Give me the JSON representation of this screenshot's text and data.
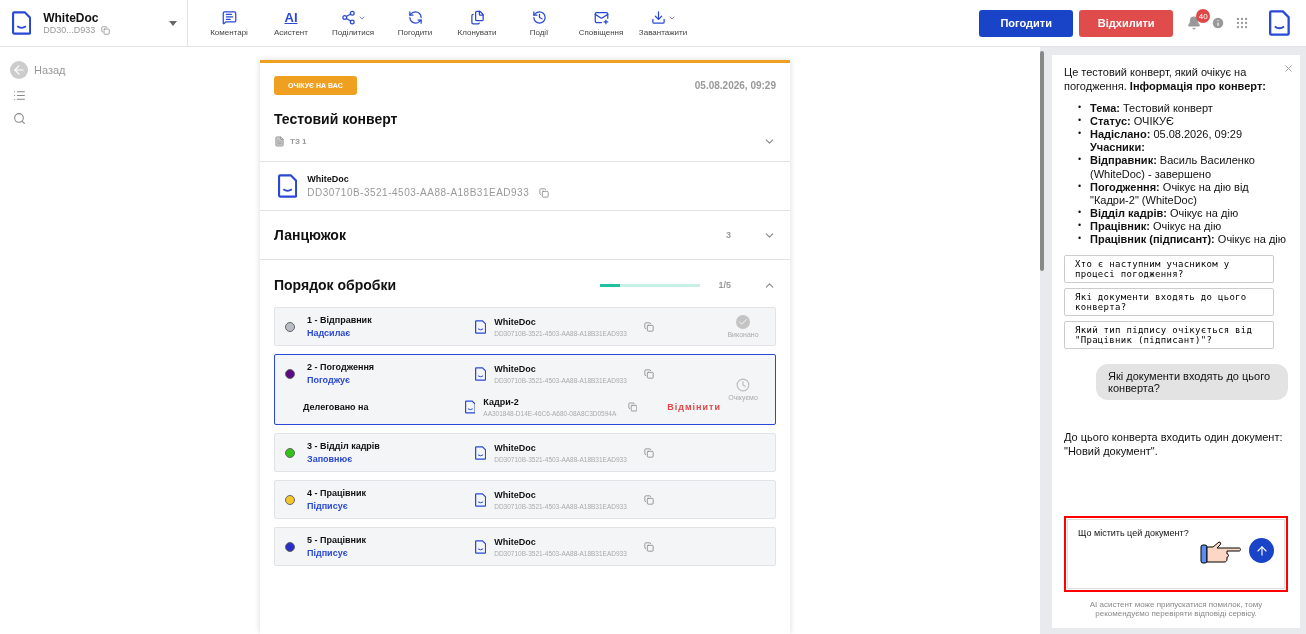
{
  "header": {
    "doc_name": "WhiteDoc",
    "doc_id": "DD30...D933",
    "toolbar": [
      {
        "label": "Коментарі",
        "dropdown": false
      },
      {
        "label": "Асистент",
        "glyph": "AI",
        "dropdown": false
      },
      {
        "label": "Поділитися",
        "dropdown": true
      },
      {
        "label": "Погодити",
        "dropdown": false
      },
      {
        "label": "Клонувати",
        "dropdown": false
      },
      {
        "label": "Події",
        "dropdown": false
      },
      {
        "label": "Сповіщення",
        "dropdown": false
      },
      {
        "label": "Завантажити",
        "dropdown": true
      }
    ],
    "approve": "Погодити",
    "reject": "Відхилити",
    "notification_count": "40"
  },
  "sidebar": {
    "back": "Назад"
  },
  "envelope": {
    "status": "ОЧІКУЄ НА ВАС",
    "date": "05.08.2026, 09:29",
    "title": "Тестовий конверт",
    "doc_type": "ТЗ 1",
    "document": {
      "name": "WhiteDoc",
      "id": "DD30710B-3521-4503-AA88-A18B31EAD933"
    },
    "chain": {
      "title": "Ланцюжок",
      "count": "3",
      "expanded": false
    },
    "processing": {
      "title": "Порядок обробки",
      "level": 0.2,
      "progress": "1/5",
      "expanded": true,
      "steps": [
        {
          "title": "1 - Відправник",
          "action": "Надсилає",
          "color": "#b8bcc4",
          "name": "WhiteDoc",
          "id": "DD30710B-3521-4503-AA88-A18B31EAD933",
          "kind": "done",
          "status_label": "Виконано",
          "selected": false
        },
        {
          "title": "2 - Погодження",
          "action": "Погоджує",
          "color": "#5a0a82",
          "name": "WhiteDoc",
          "id": "DD30710B-3521-4503-AA88-A18B31EAD933",
          "kind": "waiting",
          "status_label": "Очікуємо",
          "selected": true,
          "delegation": {
            "label": "Делеговано на",
            "name": "Кадри-2",
            "id": "AA301848-D14E-46C6-A680-08A8C3D0594A",
            "cancel": "Відмінити"
          }
        },
        {
          "title": "3 - Відділ кадрів",
          "action": "Заповнює",
          "color": "#33c21a",
          "name": "WhiteDoc",
          "id": "DD30710B-3521-4503-AA88-A18B31EAD933",
          "kind": "plain",
          "selected": false
        },
        {
          "title": "4 - Працівник",
          "action": "Підписує",
          "color": "#f5c52a",
          "name": "WhiteDoc",
          "id": "DD30710B-3521-4503-AA88-A18B31EAD933",
          "kind": "plain",
          "selected": false
        },
        {
          "title": "5 - Працівник",
          "action": "Підписує",
          "color": "#2a2ec4",
          "name": "WhiteDoc",
          "id": "DD30710B-3521-4503-AA88-A18B31EAD933",
          "kind": "plain",
          "selected": false
        }
      ]
    }
  },
  "chat": {
    "intro": "Це тестовий конверт, який очікує на погодження. **Інформація про конверт:**",
    "info": [
      {
        "kind": "bullet",
        "marker": "•",
        "text": "**Тема:** Тестовий конверт"
      },
      {
        "kind": "bullet",
        "marker": "•",
        "text": "**Статус:** ОЧІКУЄ"
      },
      {
        "kind": "bullet",
        "marker": "•",
        "text": "**Надіслано:** 05.08.2026, 09:29"
      },
      {
        "kind": "heading",
        "text": "Учасники:"
      },
      {
        "kind": "bullet",
        "marker": "•",
        "text": "**Відправник:** Василь Василенко (WhiteDoc) - завершено"
      },
      {
        "kind": "bullet",
        "marker": "•",
        "text": "**Погодження:** Очікує на дію від \"Кадри-2\" (WhiteDoc)"
      },
      {
        "kind": "bullet",
        "marker": "•",
        "text": "**Відділ кадрів:** Очікує на дію"
      },
      {
        "kind": "bullet",
        "marker": "•",
        "text": "**Працівник:** Очікує на дію"
      },
      {
        "kind": "bullet",
        "marker": "•",
        "text": "**Працівник (підписант):** Очікує на дію"
      }
    ],
    "suggestions": [
      "Хто є наступним учасником у процесі погодження?",
      "Які документи входять до цього конверта?",
      "Який тип підпису очікується від \"Працівник (підписант)\"?"
    ],
    "user_message": "Які документи входять до цього конверта?",
    "answer": "До цього конверта входить один документ: \"Новий документ\".",
    "input_value": "Що містить цей документ?",
    "disclaimer": "AI асистент може припускатися помилок, тому рекомендуємо перевіряти відповіді сервісу."
  }
}
